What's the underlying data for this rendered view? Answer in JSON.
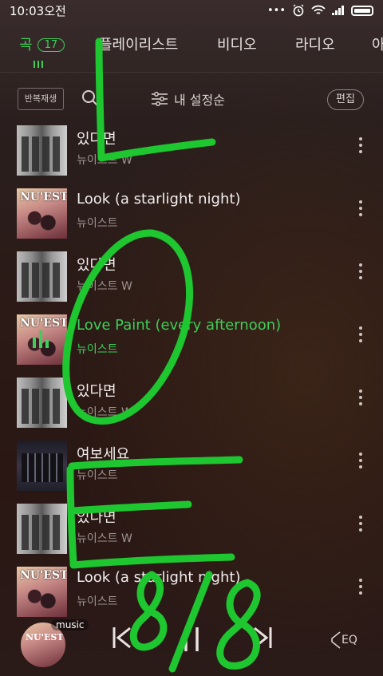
{
  "status_bar": {
    "time": "10:03오전",
    "dots": "•••"
  },
  "tabs": [
    {
      "label": "곡",
      "count": "17",
      "active": true
    },
    {
      "label": "플레이리스트"
    },
    {
      "label": "비디오"
    },
    {
      "label": "라디오"
    },
    {
      "label": "아"
    }
  ],
  "toolbar": {
    "repeat_label": "반복재생",
    "sort_label": "내 설정순",
    "edit_label": "편집"
  },
  "songs": [
    {
      "title": "있다면",
      "artist": "뉴이스트 W",
      "art": "photo"
    },
    {
      "title": "Look (a starlight night)",
      "artist": "뉴이스트",
      "art": "nuest"
    },
    {
      "title": "있다면",
      "artist": "뉴이스트 W",
      "art": "photo"
    },
    {
      "title": "Love Paint (every afternoon)",
      "artist": "뉴이스트",
      "art": "nuest",
      "playing": true
    },
    {
      "title": "있다면",
      "artist": "뉴이스트 W",
      "art": "photo"
    },
    {
      "title": "여보세요",
      "artist": "뉴이스트",
      "art": "night"
    },
    {
      "title": "있다면",
      "artist": "뉴이스트 W",
      "art": "photo"
    },
    {
      "title": "Look (a starlight night)",
      "artist": "뉴이스트",
      "art": "nuest"
    }
  ],
  "player": {
    "badge": "music",
    "eq_label": "EQ"
  },
  "colors": {
    "accent": "#3fce5a",
    "scribble": "#1ec62f"
  },
  "handwriting": [
    "L",
    "O",
    "E",
    "8/8"
  ]
}
